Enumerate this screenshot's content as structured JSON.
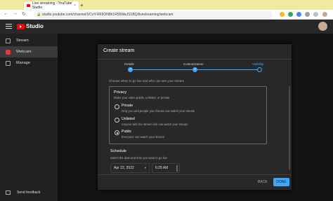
{
  "browser": {
    "tab_title": "Live streaming - YouTube Studio",
    "tab_close": "×",
    "new_tab": "+",
    "url": "studio.youtube.com/channel/UCoY-R65ON8h1R56WaJS1BQ/livestreaming/webcam",
    "icons": [
      "back-icon",
      "forward-icon",
      "reload-icon",
      "lock-icon"
    ]
  },
  "header": {
    "logo_text": "Studio"
  },
  "sidebar": {
    "items": [
      {
        "label": "Stream",
        "icon": "stream-icon"
      },
      {
        "label": "Webcam",
        "icon": "webcam-icon"
      },
      {
        "label": "Manage",
        "icon": "manage-icon"
      }
    ],
    "feedback": "Send feedback"
  },
  "dialog": {
    "title": "Create stream",
    "steps": [
      {
        "label": "Details",
        "state": "done"
      },
      {
        "label": "Customization",
        "state": "done"
      },
      {
        "label": "Visibility",
        "state": "current"
      }
    ],
    "intro": "Choose when to go live and who can see your stream",
    "privacy": {
      "title": "Privacy",
      "subtitle": "Make your video public, unlisted, or private",
      "options": [
        {
          "label": "Private",
          "desc": "Only you and people you choose can watch your stream",
          "selected": false
        },
        {
          "label": "Unlisted",
          "desc": "Anyone with the stream link can watch your stream",
          "selected": false
        },
        {
          "label": "Public",
          "desc": "Everyone can watch your stream",
          "selected": true
        }
      ]
    },
    "schedule": {
      "title": "Schedule",
      "subtitle": "Select the date and time you want to go live",
      "date": "Apr 22, 2022",
      "time": "6:25 AM"
    },
    "back_label": "BACK",
    "done_label": "DONE"
  },
  "colors": {
    "accent": "#3ea6ff",
    "brand": "#ff0000"
  }
}
